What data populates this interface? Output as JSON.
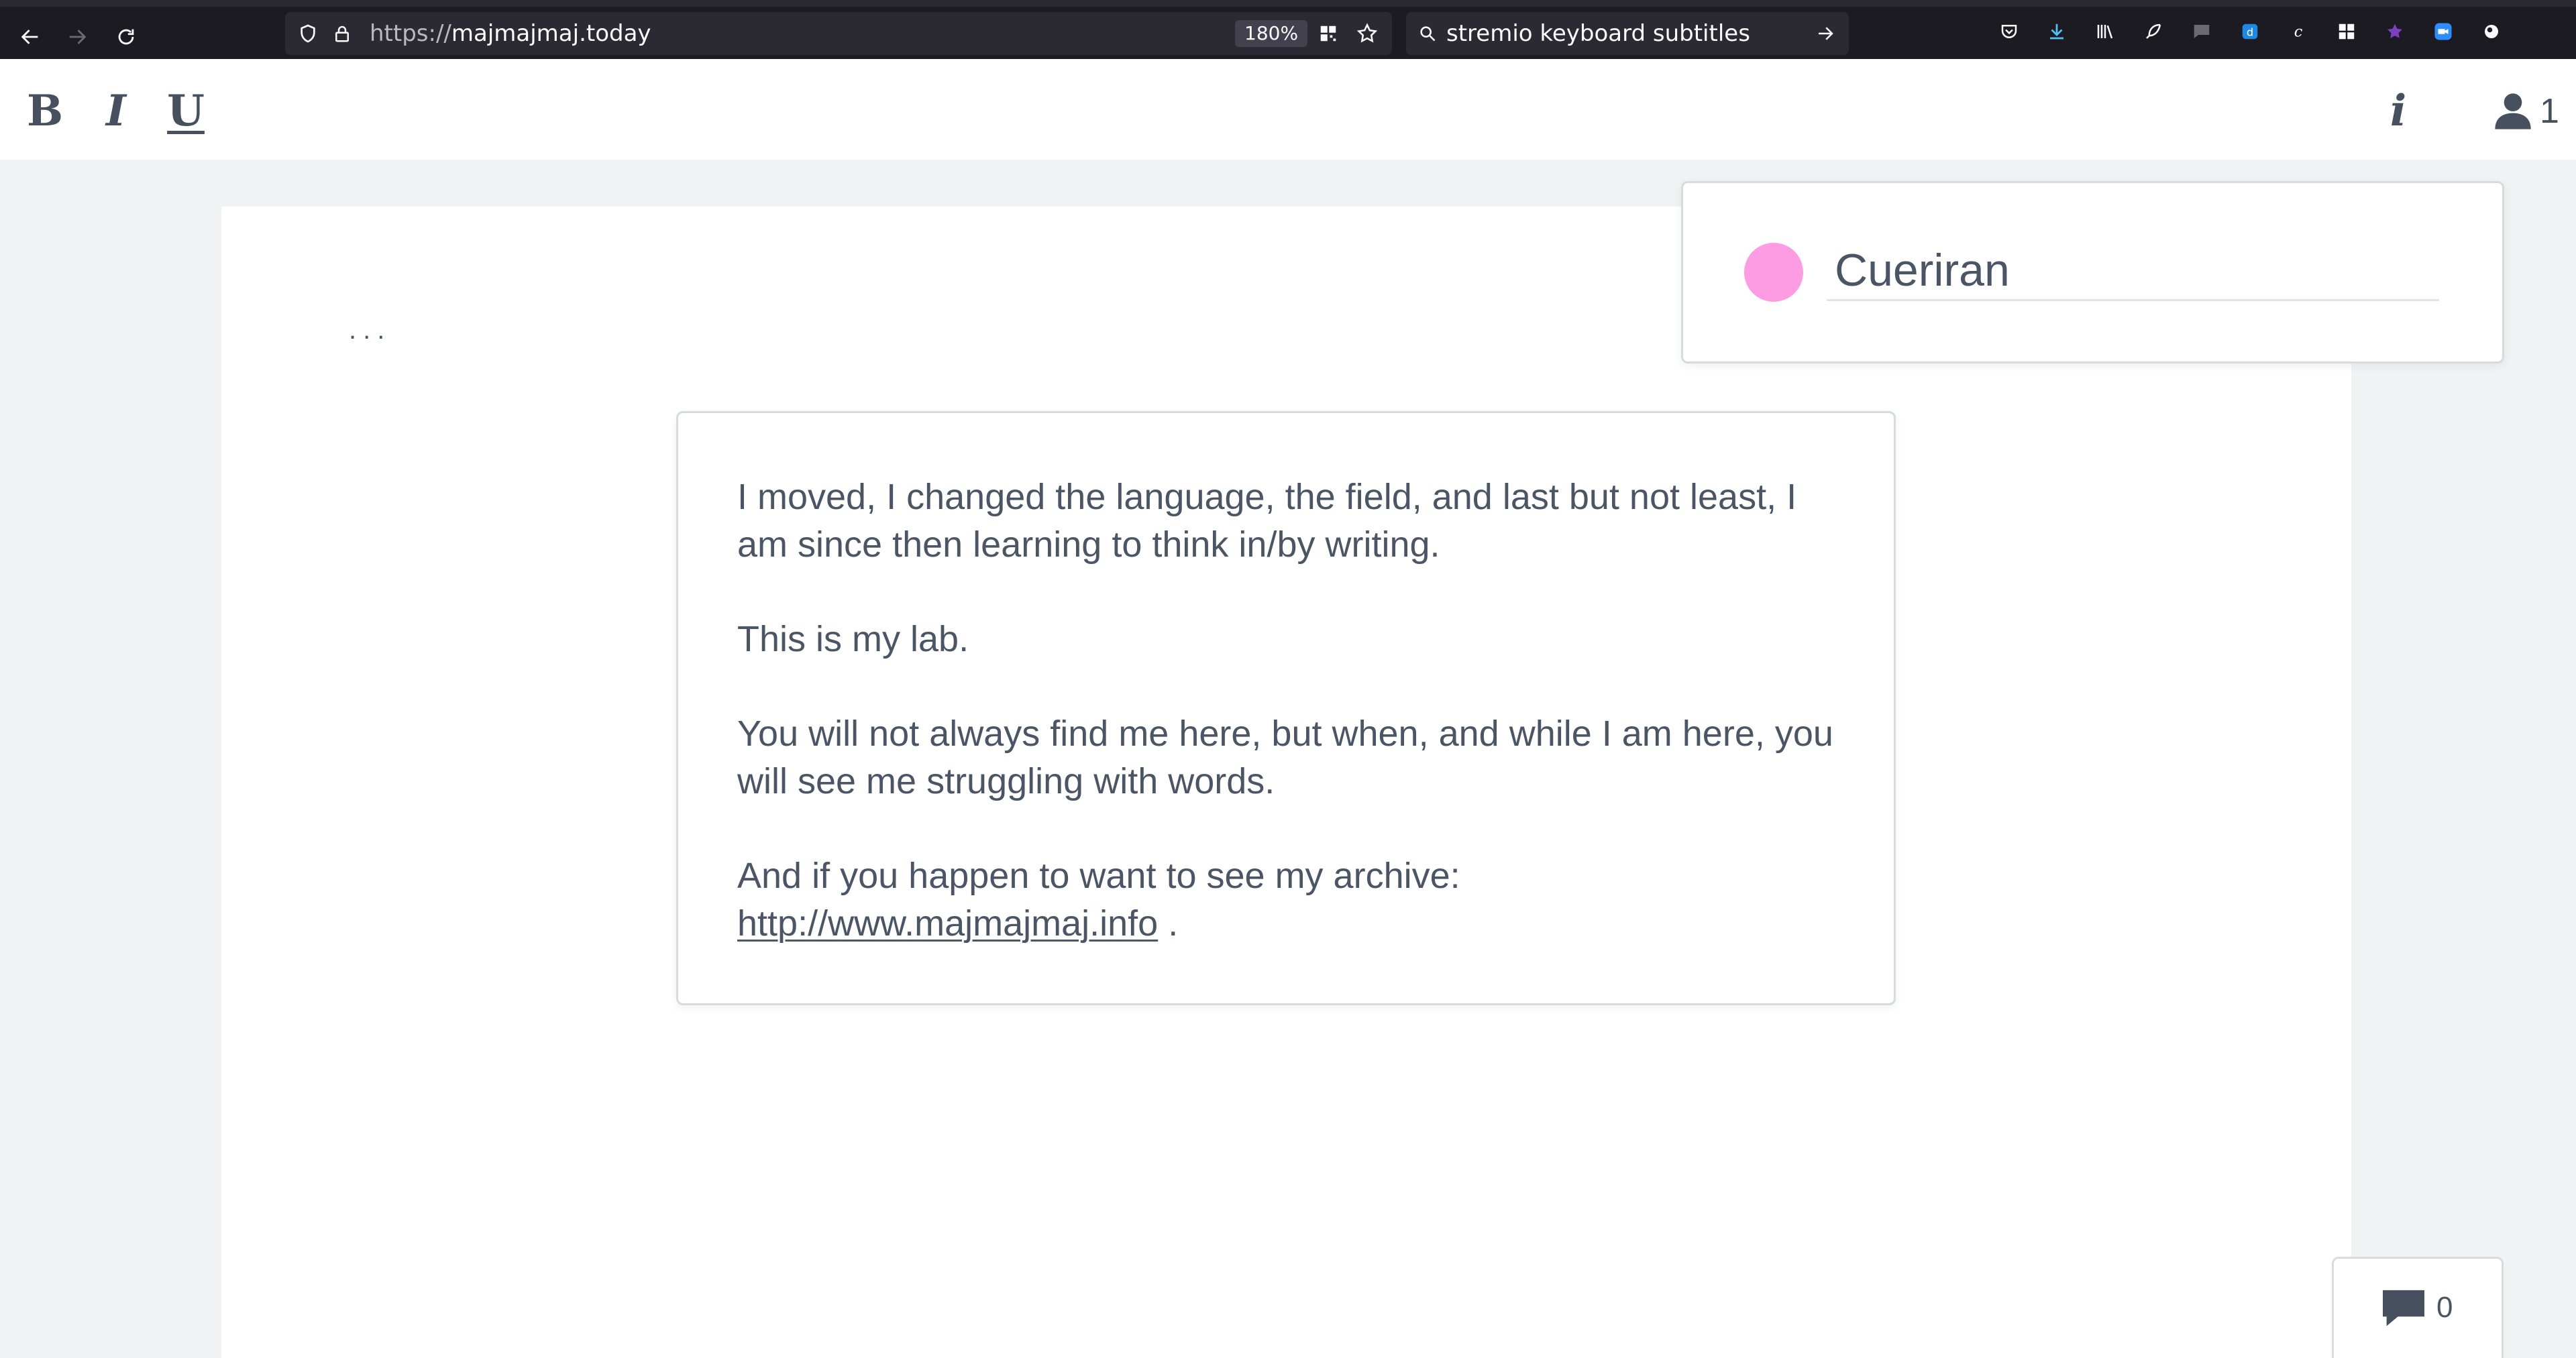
{
  "browser": {
    "url_scheme": "https://",
    "url_host": "majmajmaj.today",
    "zoom": "180%",
    "search_text": "stremio keyboard subtitles"
  },
  "toolbar": {
    "bold_label": "B",
    "italic_label": "I",
    "underline_label": "U",
    "info_label": "i",
    "users_count": "1"
  },
  "document": {
    "ellipsis": "...",
    "paragraphs": [
      "I moved, I changed the language, the field, and last but not least, I am since then learning to think in/by writing.",
      "This is my lab.",
      "You will not always find me here, but when, and while I am here, you will see me struggling with words."
    ],
    "archive_text": "And if you happen to want to see my archive:",
    "archive_link": "http://www.majmajmaj.info",
    "archive_suffix": " ."
  },
  "user": {
    "name": "Cueriran",
    "color": "#fe9ce3"
  },
  "comments": {
    "count": "0"
  }
}
